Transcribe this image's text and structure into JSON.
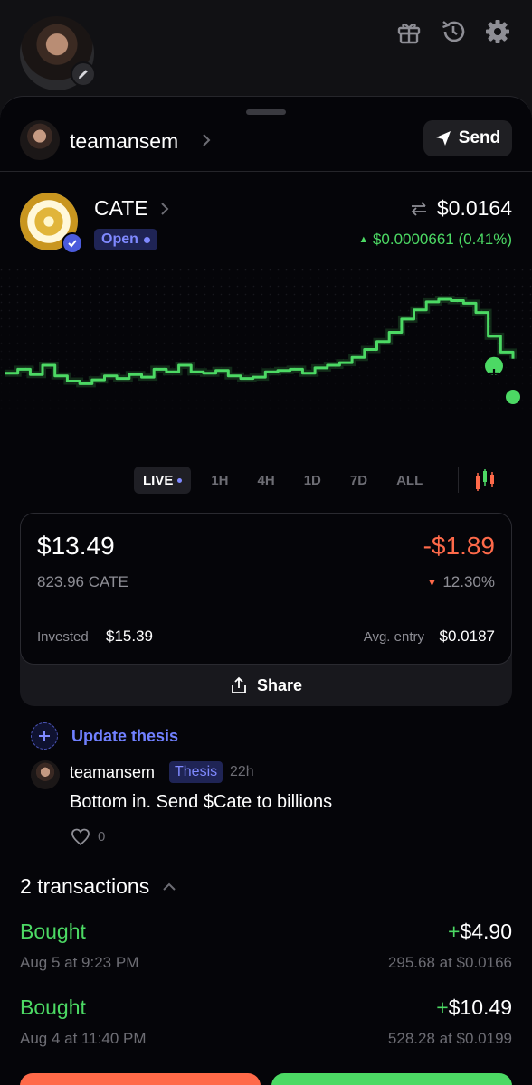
{
  "user": {
    "name": "teamansem"
  },
  "header": {
    "send_label": "Send"
  },
  "token": {
    "name": "CATE",
    "status": "Open",
    "price": "$0.0164",
    "change": "$0.0000661 (0.41%)"
  },
  "chart_data": {
    "type": "line",
    "title": "",
    "xlabel": "",
    "ylabel": "",
    "series": [
      {
        "values": [
          0.44,
          0.47,
          0.43,
          0.5,
          0.42,
          0.38,
          0.36,
          0.39,
          0.42,
          0.4,
          0.43,
          0.41,
          0.47,
          0.45,
          0.5,
          0.45,
          0.44,
          0.46,
          0.42,
          0.4,
          0.41,
          0.45,
          0.46,
          0.47,
          0.44,
          0.48,
          0.5,
          0.52,
          0.56,
          0.62,
          0.68,
          0.75,
          0.85,
          0.92,
          0.98,
          1.0,
          0.99,
          0.97,
          0.9,
          0.72,
          0.6,
          0.55
        ]
      }
    ],
    "grid": false,
    "color": "#4cd964"
  },
  "ranges": [
    "LIVE",
    "1H",
    "4H",
    "1D",
    "7D",
    "ALL"
  ],
  "position": {
    "value": "$13.49",
    "pnl": "-$1.89",
    "qty": "823.96 CATE",
    "pct": "12.30%",
    "invested_label": "Invested",
    "invested": "$15.39",
    "avg_label": "Avg. entry",
    "avg": "$0.0187",
    "share_label": "Share"
  },
  "thesis": {
    "update_label": "Update thesis",
    "user": "teamansem",
    "tag": "Thesis",
    "time": "22h",
    "text": "Bottom in. Send $Cate to billions",
    "likes": "0"
  },
  "transactions": {
    "title": "2 transactions",
    "items": [
      {
        "type": "Bought",
        "sign": "+",
        "amount": "$4.90",
        "date": "Aug 5 at 9:23 PM",
        "detail": "295.68 at $0.0166"
      },
      {
        "type": "Bought",
        "sign": "+",
        "amount": "$10.49",
        "date": "Aug 4 at 11:40 PM",
        "detail": "528.28 at $0.0199"
      }
    ]
  },
  "colors": {
    "positive": "#4cd964",
    "negative": "#ff6a4a",
    "accent": "#7f89ff"
  }
}
